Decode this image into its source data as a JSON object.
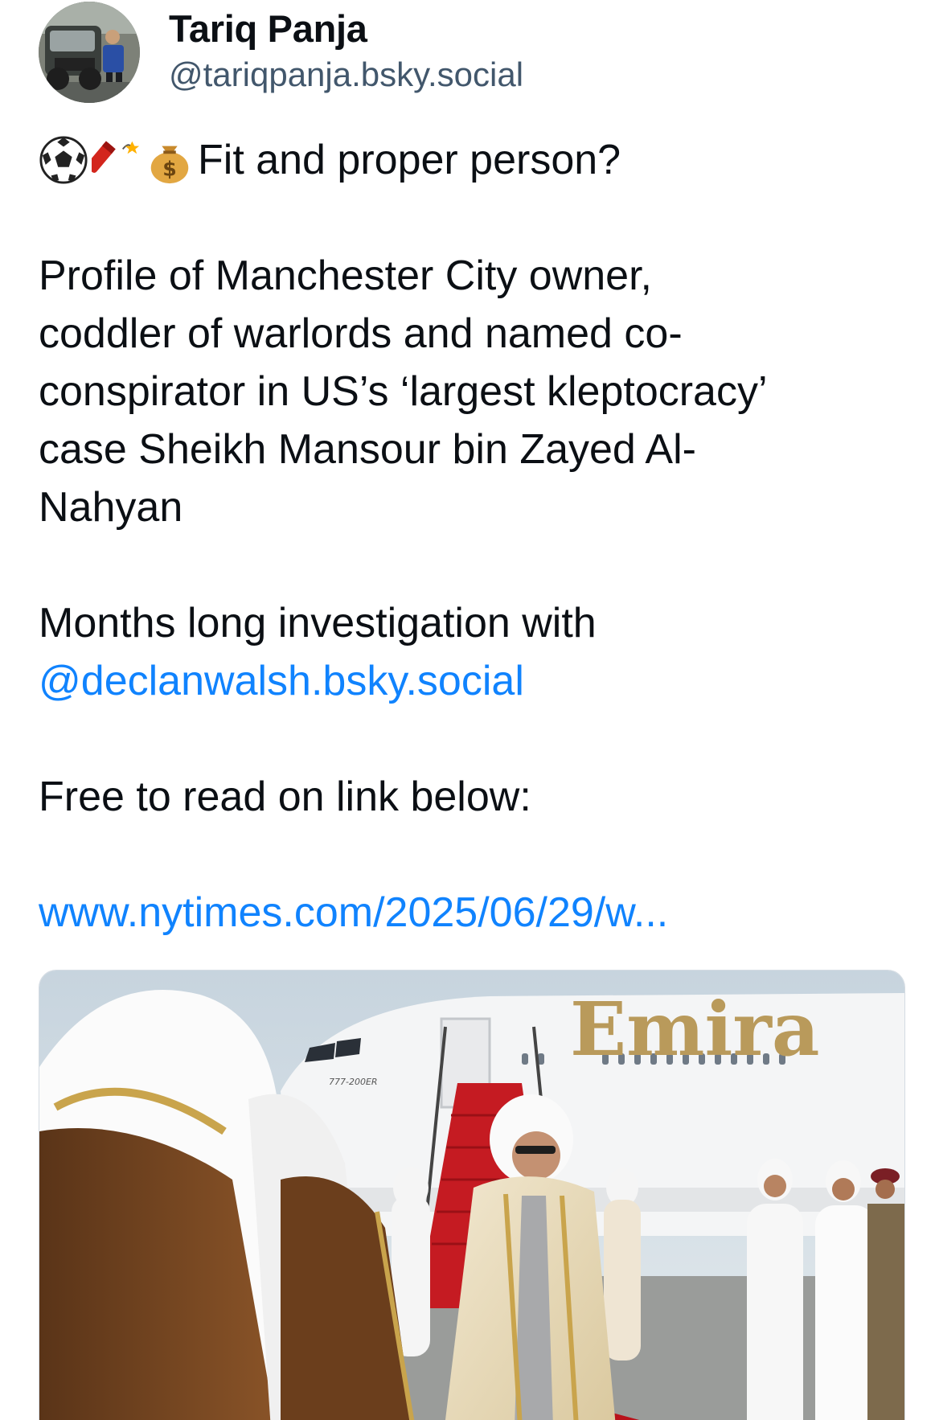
{
  "author": {
    "display_name": "Tariq Panja",
    "handle": "@tariqpanja.bsky.social",
    "avatar_icon": "profile-photo"
  },
  "post": {
    "emoji_icons": [
      "soccer-ball-icon",
      "firecracker-icon",
      "money-bag-icon"
    ],
    "headline": "Fit and proper person?",
    "profile_lines": [
      "Profile of Manchester City owner,",
      "coddler of warlords and named co-",
      "conspirator in US’s ‘largest kleptocracy’",
      "case Sheikh Mansour bin Zayed Al-",
      "Nahyan"
    ],
    "investigation_text": "Months long investigation with",
    "mention": "@declanwalsh.bsky.social",
    "free_read_text": "Free to read on link below:",
    "link_text": "www.nytimes.com/2025/06/29/w..."
  },
  "embed": {
    "image_description_icon": "photo-emirates-airplane-welcome",
    "aircraft_lettering": "Emira",
    "aircraft_model_mark": "777-200ER"
  },
  "colors": {
    "link": "#1083fe",
    "text": "#0b0f14",
    "handle": "#42576c"
  }
}
